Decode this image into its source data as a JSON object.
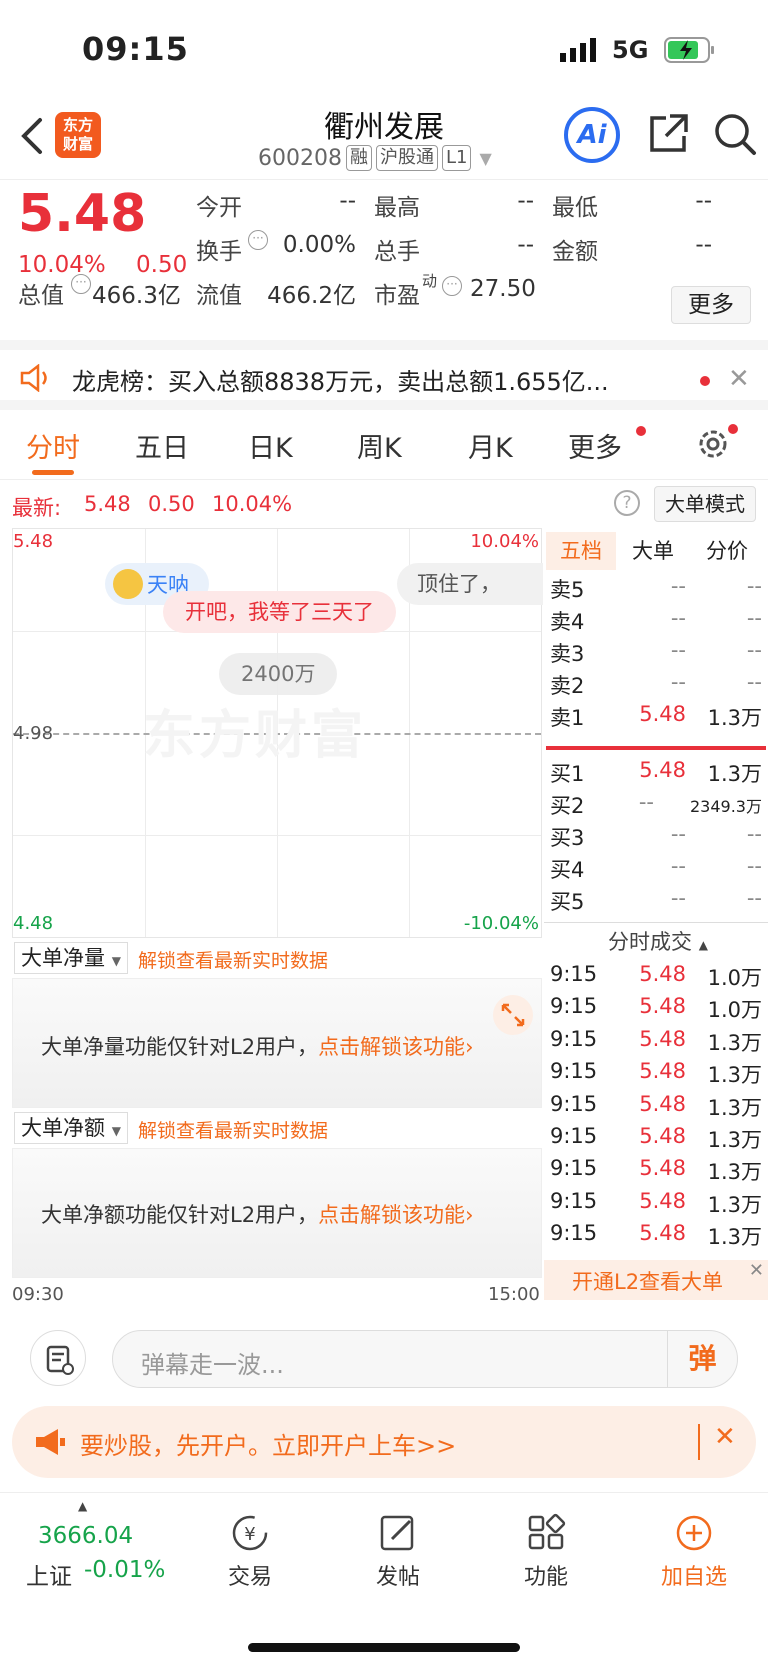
{
  "status": {
    "time": "09:15",
    "network": "5G"
  },
  "header": {
    "logo_line1": "东方",
    "logo_line2": "财富",
    "title": "衢州发展",
    "code": "600208",
    "tags": [
      "融",
      "沪股通",
      "L1"
    ],
    "ai_label": "Ai"
  },
  "quote": {
    "price": "5.48",
    "change_pct": "10.04%",
    "change": "0.50",
    "open_label": "今开",
    "open": "--",
    "high_label": "最高",
    "high": "--",
    "low_label": "最低",
    "low": "--",
    "turnover_label": "换手",
    "turnover": "0.00%",
    "volume_label": "总手",
    "volume": "--",
    "amount_label": "金额",
    "amount": "--",
    "mktcap_label": "总值",
    "mktcap": "466.3亿",
    "float_label": "流值",
    "float": "466.2亿",
    "pe_label": "市盈",
    "pe_sup": "动",
    "pe": "27.50",
    "more": "更多"
  },
  "lhb": {
    "text": "龙虎榜：买入总额8838万元，卖出总额1.655亿..."
  },
  "tabs": [
    "分时",
    "五日",
    "日K",
    "周K",
    "月K",
    "更多"
  ],
  "latest": {
    "label": "最新:",
    "price": "5.48",
    "change": "0.50",
    "pct": "10.04%",
    "mode": "大单模式"
  },
  "chart": {
    "y_top": "5.48",
    "y_mid": "4.98",
    "y_bottom": "4.48",
    "pct_top": "10.04%",
    "pct_bottom": "-10.04%",
    "x_start": "09:30",
    "x_end": "15:00",
    "watermark": "东方财富",
    "danmu": [
      "天呐",
      "顶住了，",
      "开吧，我等了三天了",
      "2400万"
    ]
  },
  "panels": {
    "p1_select": "大单净量",
    "p1_unlock": "解锁查看最新实时数据",
    "p1_msg": "大单净量功能仅针对L2用户，",
    "p1_link": "点击解锁该功能",
    "p2_select": "大单净额",
    "p2_unlock": "解锁查看最新实时数据",
    "p2_msg": "大单净额功能仅针对L2用户，",
    "p2_link": "点击解锁该功能"
  },
  "orderbook": {
    "tabs": [
      "五档",
      "大单",
      "分价"
    ],
    "asks": [
      {
        "label": "卖5",
        "price": "--",
        "vol": "--"
      },
      {
        "label": "卖4",
        "price": "--",
        "vol": "--"
      },
      {
        "label": "卖3",
        "price": "--",
        "vol": "--"
      },
      {
        "label": "卖2",
        "price": "--",
        "vol": "--"
      },
      {
        "label": "卖1",
        "price": "5.48",
        "vol": "1.3万"
      }
    ],
    "bids": [
      {
        "label": "买1",
        "price": "5.48",
        "vol": "1.3万"
      },
      {
        "label": "买2",
        "price": "--",
        "vol": "2349.3万"
      },
      {
        "label": "买3",
        "price": "--",
        "vol": "--"
      },
      {
        "label": "买4",
        "price": "--",
        "vol": "--"
      },
      {
        "label": "买5",
        "price": "--",
        "vol": "--"
      }
    ],
    "trades_title": "分时成交",
    "trades": [
      {
        "t": "9:15",
        "p": "5.48",
        "v": "1.0万"
      },
      {
        "t": "9:15",
        "p": "5.48",
        "v": "1.0万"
      },
      {
        "t": "9:15",
        "p": "5.48",
        "v": "1.3万"
      },
      {
        "t": "9:15",
        "p": "5.48",
        "v": "1.3万"
      },
      {
        "t": "9:15",
        "p": "5.48",
        "v": "1.3万"
      },
      {
        "t": "9:15",
        "p": "5.48",
        "v": "1.3万"
      },
      {
        "t": "9:15",
        "p": "5.48",
        "v": "1.3万"
      },
      {
        "t": "9:15",
        "p": "5.48",
        "v": "1.3万"
      },
      {
        "t": "9:15",
        "p": "5.48",
        "v": "1.3万"
      }
    ],
    "l2_banner": "开通L2查看大单"
  },
  "danmu_bar": {
    "placeholder": "弹幕走一波...",
    "send": "弹"
  },
  "ad": {
    "text": "要炒股，先开户。立即开户上车>>"
  },
  "tabbar": {
    "index_value": "3666.04",
    "index_name": "上证",
    "index_change": "-0.01%",
    "items": [
      "交易",
      "发帖",
      "功能",
      "加自选"
    ]
  }
}
